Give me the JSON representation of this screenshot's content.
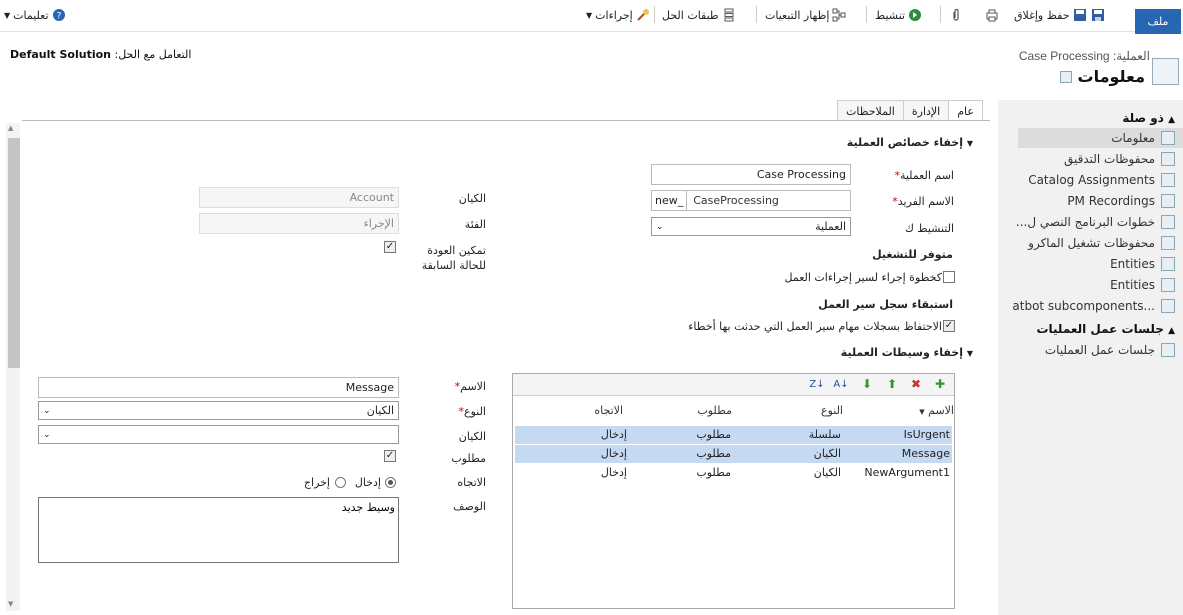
{
  "toolbar": {
    "file": "ملف",
    "save_close": "حفظ وإغلاق",
    "activate": "تنشيط",
    "show_dependencies": "إظهار التبعيات",
    "solution_layers": "طبقات الحل",
    "actions": "إجراءات",
    "help": "تعليمات"
  },
  "header": {
    "solution_label": "التعامل مع الحل:",
    "solution_name": "Default Solution",
    "entity_sub": "العملية: Case Processing",
    "entity_title": "معلومات"
  },
  "nav": {
    "related_title": "ذو صلة",
    "items": [
      "معلومات",
      "محفوظات التدقيق",
      "Catalog Assignments",
      "PM Recordings",
      "خطوات البرنامج النصي ل...",
      "محفوظات تشغيل الماكرو",
      "Entities",
      "Entities",
      "...atbot subcomponents"
    ],
    "sessions_title": "جلسات عمل العمليات",
    "sessions_item": "جلسات عمل العمليات"
  },
  "tabs": [
    "عام",
    "الإدارة",
    "الملاحظات"
  ],
  "properties": {
    "section_title": "إخفاء خصائص العملية",
    "process_name_label": "اسم العملية",
    "process_name": "Case Processing",
    "unique_name_label": "الاسم الفريد",
    "unique_prefix": "new_",
    "unique_name": "CaseProcessing",
    "activate_as_label": "التنشيط ك",
    "activate_as": "العملية",
    "entity_label": "الكيان",
    "entity_value": "Account",
    "category_label": "الفئة",
    "category_value": "الإجراء",
    "rollback_label_1": "تمكين العودة",
    "rollback_label_2": "للحالة السابقة",
    "available_label": "متوفر للتشغيل",
    "available_option": "كخطوة إجراء لسير إجراءات العمل",
    "retention_label": "استبقاء سجل سير العمل",
    "retention_option": "الاحتفاظ بسجلات مهام سير العمل التي حدثت بها أخطاء"
  },
  "arguments": {
    "section_title": "إخفاء وسيطات العملية",
    "columns": [
      "الاسم",
      "النوع",
      "مطلوب",
      "الاتجاه"
    ],
    "rows": [
      {
        "name": "IsUrgent",
        "type": "سلسلة",
        "required": "مطلوب",
        "direction": "إدخال"
      },
      {
        "name": "Message",
        "type": "الكيان",
        "required": "مطلوب",
        "direction": "إدخال"
      },
      {
        "name": "NewArgument1",
        "type": "الكيان",
        "required": "مطلوب",
        "direction": "إدخال"
      }
    ],
    "name_label": "الاسم",
    "name_value": "Message",
    "type_label": "النوع",
    "type_value": "الكيان",
    "entity_label": "الكيان",
    "entity_value": "",
    "required_label": "مطلوب",
    "direction_label": "الاتجاه",
    "direction_in": "إدخال",
    "direction_out": "إخراج",
    "description_label": "الوصف",
    "description_value": "وسيط جديد"
  }
}
